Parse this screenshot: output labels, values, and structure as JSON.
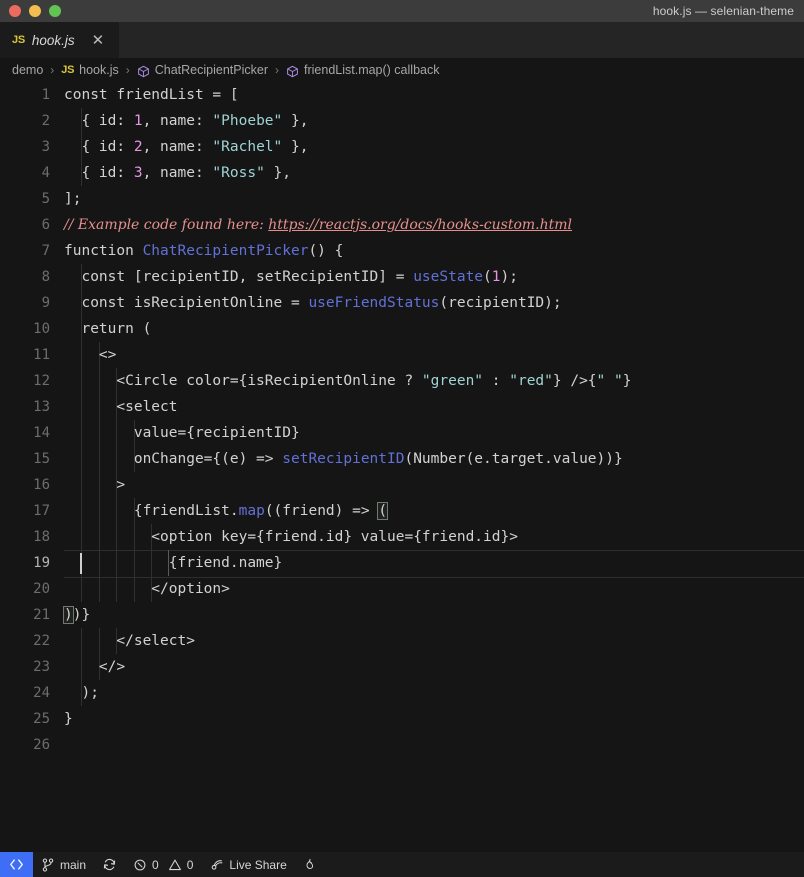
{
  "window": {
    "title": "hook.js — selenian-theme",
    "traffic_lights": [
      "close-red",
      "minimize-yellow",
      "maximize-green"
    ]
  },
  "tab": {
    "file_icon": "js-file-icon",
    "label": "hook.js",
    "close_icon": "✕",
    "preview_italic": true
  },
  "breadcrumb": {
    "items": [
      {
        "label": "demo",
        "icon": ""
      },
      {
        "label": "hook.js",
        "icon": "js-file-icon"
      },
      {
        "label": "ChatRecipientPicker",
        "icon": "symbol-cube-icon"
      },
      {
        "label": "friendList.map() callback",
        "icon": "symbol-cube-icon"
      }
    ],
    "separator": "›"
  },
  "editor": {
    "active_line": 19,
    "language": "javascript",
    "lines": [
      {
        "n": "1",
        "tokens": [
          {
            "t": "plain",
            "v": "const friendList = ["
          }
        ]
      },
      {
        "n": "2",
        "tokens": [
          {
            "t": "plain",
            "v": "  { id: "
          },
          {
            "t": "num",
            "v": "1"
          },
          {
            "t": "plain",
            "v": ", name: "
          },
          {
            "t": "str",
            "v": "\"Phoebe\""
          },
          {
            "t": "plain",
            "v": " },"
          }
        ]
      },
      {
        "n": "3",
        "tokens": [
          {
            "t": "plain",
            "v": "  { id: "
          },
          {
            "t": "num",
            "v": "2"
          },
          {
            "t": "plain",
            "v": ", name: "
          },
          {
            "t": "str",
            "v": "\"Rachel\""
          },
          {
            "t": "plain",
            "v": " },"
          }
        ]
      },
      {
        "n": "4",
        "tokens": [
          {
            "t": "plain",
            "v": "  { id: "
          },
          {
            "t": "num",
            "v": "3"
          },
          {
            "t": "plain",
            "v": ", name: "
          },
          {
            "t": "str",
            "v": "\"Ross\""
          },
          {
            "t": "plain",
            "v": " },"
          }
        ]
      },
      {
        "n": "5",
        "tokens": [
          {
            "t": "plain",
            "v": "];"
          }
        ]
      },
      {
        "n": "6",
        "tokens": [
          {
            "t": "cmt",
            "v": "// Example code found here: "
          },
          {
            "t": "link",
            "v": "https://reactjs.org/docs/hooks-custom.html"
          }
        ]
      },
      {
        "n": "7",
        "tokens": [
          {
            "t": "plain",
            "v": "function "
          },
          {
            "t": "fn",
            "v": "ChatRecipientPicker"
          },
          {
            "t": "plain",
            "v": "() {"
          }
        ]
      },
      {
        "n": "8",
        "tokens": [
          {
            "t": "plain",
            "v": "  const [recipientID, setRecipientID] = "
          },
          {
            "t": "fn",
            "v": "useState"
          },
          {
            "t": "plain",
            "v": "("
          },
          {
            "t": "num",
            "v": "1"
          },
          {
            "t": "plain",
            "v": ");"
          }
        ]
      },
      {
        "n": "9",
        "tokens": [
          {
            "t": "plain",
            "v": "  const isRecipientOnline = "
          },
          {
            "t": "fn",
            "v": "useFriendStatus"
          },
          {
            "t": "plain",
            "v": "(recipientID);"
          }
        ]
      },
      {
        "n": "10",
        "tokens": [
          {
            "t": "plain",
            "v": "  return ("
          }
        ]
      },
      {
        "n": "11",
        "tokens": [
          {
            "t": "plain",
            "v": "    <>"
          }
        ]
      },
      {
        "n": "12",
        "tokens": [
          {
            "t": "plain",
            "v": "      <Circle color={isRecipientOnline ? "
          },
          {
            "t": "str",
            "v": "\"green\""
          },
          {
            "t": "plain",
            "v": " : "
          },
          {
            "t": "str",
            "v": "\"red\""
          },
          {
            "t": "plain",
            "v": "} />{"
          },
          {
            "t": "str",
            "v": "\" \""
          },
          {
            "t": "plain",
            "v": "}"
          }
        ]
      },
      {
        "n": "13",
        "tokens": [
          {
            "t": "plain",
            "v": "      <select"
          }
        ]
      },
      {
        "n": "14",
        "tokens": [
          {
            "t": "plain",
            "v": "        value={recipientID}"
          }
        ]
      },
      {
        "n": "15",
        "tokens": [
          {
            "t": "plain",
            "v": "        onChange={(e) => "
          },
          {
            "t": "fn",
            "v": "setRecipientID"
          },
          {
            "t": "plain",
            "v": "(Number(e.target.value))}"
          }
        ]
      },
      {
        "n": "16",
        "tokens": [
          {
            "t": "plain",
            "v": "      >"
          }
        ]
      },
      {
        "n": "17",
        "tokens": [
          {
            "t": "plain",
            "v": "        {friendList."
          },
          {
            "t": "fn",
            "v": "map"
          },
          {
            "t": "plain",
            "v": "((friend) => "
          },
          {
            "t": "match",
            "v": "("
          }
        ]
      },
      {
        "n": "18",
        "tokens": [
          {
            "t": "plain",
            "v": "          <option key={friend.id} value={friend.id}>"
          }
        ]
      },
      {
        "n": "19",
        "tokens": [
          {
            "t": "plain",
            "v": "            {friend.name}"
          }
        ]
      },
      {
        "n": "20",
        "tokens": [
          {
            "t": "plain",
            "v": "          </option>"
          }
        ]
      },
      {
        "n": "21",
        "tokens": [
          {
            "t": "match",
            "v": ")"
          },
          {
            "t": "plain",
            "v": ")}"
          }
        ]
      },
      {
        "n": "22",
        "tokens": [
          {
            "t": "plain",
            "v": "      </select>"
          }
        ]
      },
      {
        "n": "23",
        "tokens": [
          {
            "t": "plain",
            "v": "    </>"
          }
        ]
      },
      {
        "n": "24",
        "tokens": [
          {
            "t": "plain",
            "v": "  );"
          }
        ]
      },
      {
        "n": "25",
        "tokens": [
          {
            "t": "plain",
            "v": "}"
          }
        ]
      },
      {
        "n": "26",
        "tokens": [
          {
            "t": "plain",
            "v": ""
          }
        ]
      }
    ]
  },
  "statusbar": {
    "remote_icon": "remote-window-icon",
    "branch_icon": "source-control-branch-icon",
    "branch_label": "main",
    "sync_icon": "sync-refresh-icon",
    "error_icon": "error-circle-icon",
    "error_count": "0",
    "warning_icon": "warning-triangle-icon",
    "warning_count": "0",
    "live_share_icon": "live-share-broadcast-icon",
    "live_share_label": "Live Share",
    "flame_icon": "flame-icon"
  },
  "colors": {
    "bg_editor": "#151515",
    "bg_titlebar": "#3c3c3c",
    "bg_tabbar": "#252526",
    "bg_tab_active": "#1b1b1b",
    "bg_statusbar": "#1b1b1b",
    "remote_blue": "#3d6ef5",
    "token_plain": "#d2d2d2",
    "token_number": "#e694e6",
    "token_string": "#9fd4d4",
    "token_function": "#6171d8",
    "token_comment": "#e5908e"
  }
}
